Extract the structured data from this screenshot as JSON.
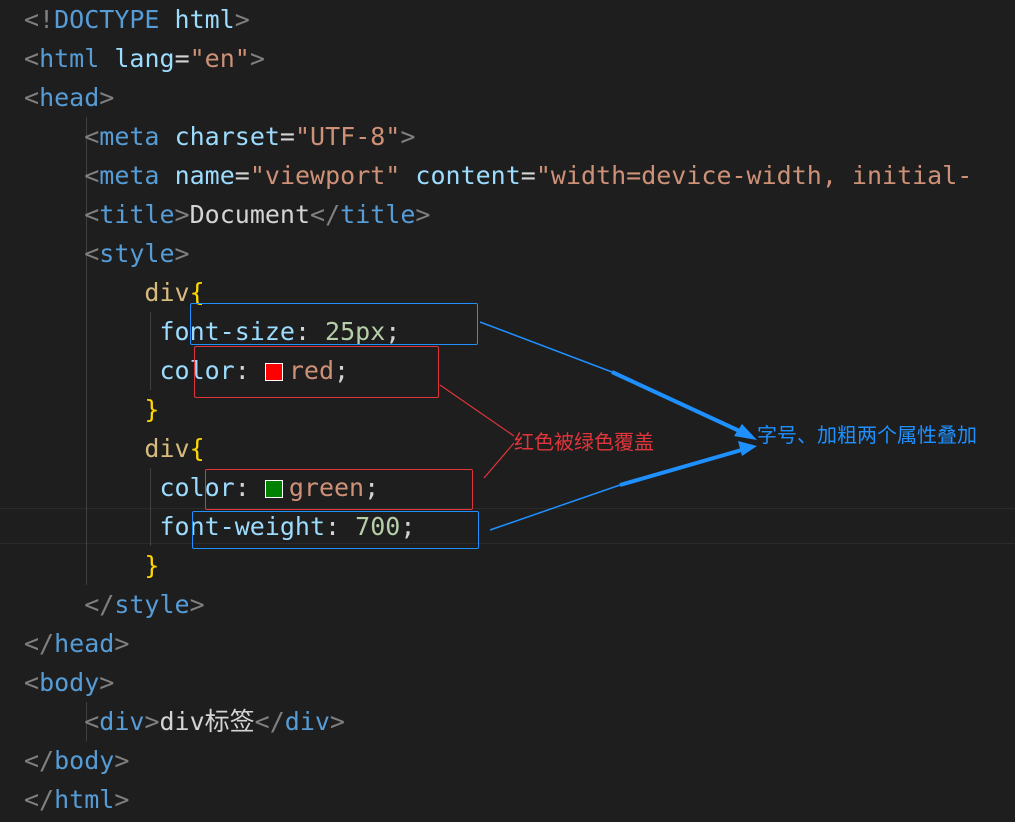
{
  "editor": {
    "lines": [
      {
        "tokens": [
          {
            "t": "<!",
            "c": "b"
          },
          {
            "t": "DOCTYPE",
            "c": "tag"
          },
          {
            "t": " "
          },
          {
            "t": "html",
            "c": "attr"
          },
          {
            "t": ">",
            "c": "b"
          }
        ]
      },
      {
        "tokens": [
          {
            "t": "<",
            "c": "b"
          },
          {
            "t": "html",
            "c": "tag"
          },
          {
            "t": " "
          },
          {
            "t": "lang",
            "c": "attr"
          },
          {
            "t": "=",
            "c": "punct"
          },
          {
            "t": "\"en\"",
            "c": "str"
          },
          {
            "t": ">",
            "c": "b"
          }
        ]
      },
      {
        "tokens": [
          {
            "t": "<",
            "c": "b"
          },
          {
            "t": "head",
            "c": "tag"
          },
          {
            "t": ">",
            "c": "b"
          }
        ]
      },
      {
        "tokens": [
          {
            "t": "    "
          },
          {
            "t": "<",
            "c": "b"
          },
          {
            "t": "meta",
            "c": "tag"
          },
          {
            "t": " "
          },
          {
            "t": "charset",
            "c": "attr"
          },
          {
            "t": "=",
            "c": "punct"
          },
          {
            "t": "\"UTF-8\"",
            "c": "str"
          },
          {
            "t": ">",
            "c": "b"
          }
        ]
      },
      {
        "tokens": [
          {
            "t": "    "
          },
          {
            "t": "<",
            "c": "b"
          },
          {
            "t": "meta",
            "c": "tag"
          },
          {
            "t": " "
          },
          {
            "t": "name",
            "c": "attr"
          },
          {
            "t": "=",
            "c": "punct"
          },
          {
            "t": "\"viewport\"",
            "c": "str"
          },
          {
            "t": " "
          },
          {
            "t": "content",
            "c": "attr"
          },
          {
            "t": "=",
            "c": "punct"
          },
          {
            "t": "\"width=device-width, initial-",
            "c": "str"
          }
        ]
      },
      {
        "tokens": [
          {
            "t": "    "
          },
          {
            "t": "<",
            "c": "b"
          },
          {
            "t": "title",
            "c": "tag"
          },
          {
            "t": ">",
            "c": "b"
          },
          {
            "t": "Document",
            "c": "text"
          },
          {
            "t": "</",
            "c": "b"
          },
          {
            "t": "title",
            "c": "tag"
          },
          {
            "t": ">",
            "c": "b"
          }
        ]
      },
      {
        "tokens": [
          {
            "t": "    "
          },
          {
            "t": "<",
            "c": "b"
          },
          {
            "t": "style",
            "c": "tag"
          },
          {
            "t": ">",
            "c": "b"
          }
        ]
      },
      {
        "tokens": [
          {
            "t": "        "
          },
          {
            "t": "div",
            "c": "sel"
          },
          {
            "t": "{",
            "c": "brace"
          }
        ]
      },
      {
        "tokens": [
          {
            "t": "         "
          },
          {
            "t": "font-size",
            "c": "prop"
          },
          {
            "t": ": ",
            "c": "punct"
          },
          {
            "t": "25px",
            "c": "num"
          },
          {
            "t": ";",
            "c": "punct"
          }
        ]
      },
      {
        "tokens": [
          {
            "t": "         "
          },
          {
            "t": "color",
            "c": "prop"
          },
          {
            "t": ": ",
            "c": "punct"
          },
          {
            "swatch": "#ff0000"
          },
          {
            "t": "red",
            "c": "val"
          },
          {
            "t": ";",
            "c": "punct"
          }
        ]
      },
      {
        "tokens": [
          {
            "t": "        "
          },
          {
            "t": "}",
            "c": "brace"
          }
        ]
      },
      {
        "tokens": [
          {
            "t": "        "
          },
          {
            "t": "div",
            "c": "sel"
          },
          {
            "t": "{",
            "c": "brace"
          }
        ]
      },
      {
        "tokens": [
          {
            "t": "         "
          },
          {
            "t": "color",
            "c": "prop"
          },
          {
            "t": ": ",
            "c": "punct"
          },
          {
            "swatch": "#008000"
          },
          {
            "t": "green",
            "c": "val"
          },
          {
            "t": ";",
            "c": "punct"
          }
        ]
      },
      {
        "tokens": [
          {
            "t": "         "
          },
          {
            "t": "font-weight",
            "c": "prop"
          },
          {
            "t": ": ",
            "c": "punct"
          },
          {
            "t": "700",
            "c": "num"
          },
          {
            "t": ";",
            "c": "punct"
          }
        ]
      },
      {
        "tokens": [
          {
            "t": "        "
          },
          {
            "t": "}",
            "c": "brace"
          }
        ]
      },
      {
        "tokens": [
          {
            "t": "    "
          },
          {
            "t": "</",
            "c": "b"
          },
          {
            "t": "style",
            "c": "tag"
          },
          {
            "t": ">",
            "c": "b"
          }
        ]
      },
      {
        "tokens": [
          {
            "t": "</",
            "c": "b"
          },
          {
            "t": "head",
            "c": "tag"
          },
          {
            "t": ">",
            "c": "b"
          }
        ]
      },
      {
        "tokens": [
          {
            "t": "<",
            "c": "b"
          },
          {
            "t": "body",
            "c": "tag"
          },
          {
            "t": ">",
            "c": "b"
          }
        ]
      },
      {
        "tokens": [
          {
            "t": "    "
          },
          {
            "t": "<",
            "c": "b"
          },
          {
            "t": "div",
            "c": "tag"
          },
          {
            "t": ">",
            "c": "b"
          },
          {
            "t": "div标签",
            "c": "text"
          },
          {
            "t": "</",
            "c": "b"
          },
          {
            "t": "div",
            "c": "tag"
          },
          {
            "t": ">",
            "c": "b"
          }
        ]
      },
      {
        "tokens": [
          {
            "t": "</",
            "c": "b"
          },
          {
            "t": "body",
            "c": "tag"
          },
          {
            "t": ">",
            "c": "b"
          }
        ]
      },
      {
        "tokens": [
          {
            "t": "</",
            "c": "b"
          },
          {
            "t": "html",
            "c": "tag"
          },
          {
            "t": ">",
            "c": "b"
          }
        ]
      }
    ]
  },
  "annotations": {
    "red_note": "红色被绿色覆盖",
    "blue_note": "字号、加粗两个属性叠加",
    "red_color": "#e0353b",
    "blue_color": "#1e90ff"
  }
}
